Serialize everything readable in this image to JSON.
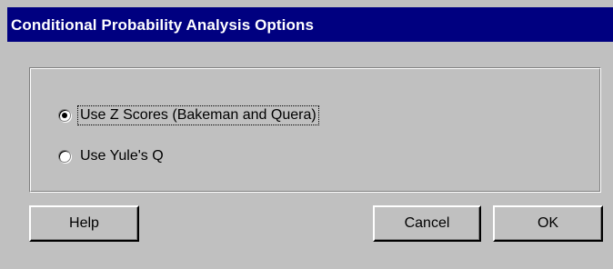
{
  "window": {
    "title": "Conditional Probability Analysis Options"
  },
  "options": {
    "items": [
      {
        "label": "Use Z Scores (Bakeman and Quera)",
        "selected": true
      },
      {
        "label": "Use Yule's Q",
        "selected": false
      }
    ]
  },
  "buttons": {
    "help_label": "Help",
    "cancel_label": "Cancel",
    "ok_label": "OK"
  },
  "colors": {
    "titlebar": "#000080",
    "dialog_face": "#c0c0c0",
    "title_text": "#ffffff"
  }
}
